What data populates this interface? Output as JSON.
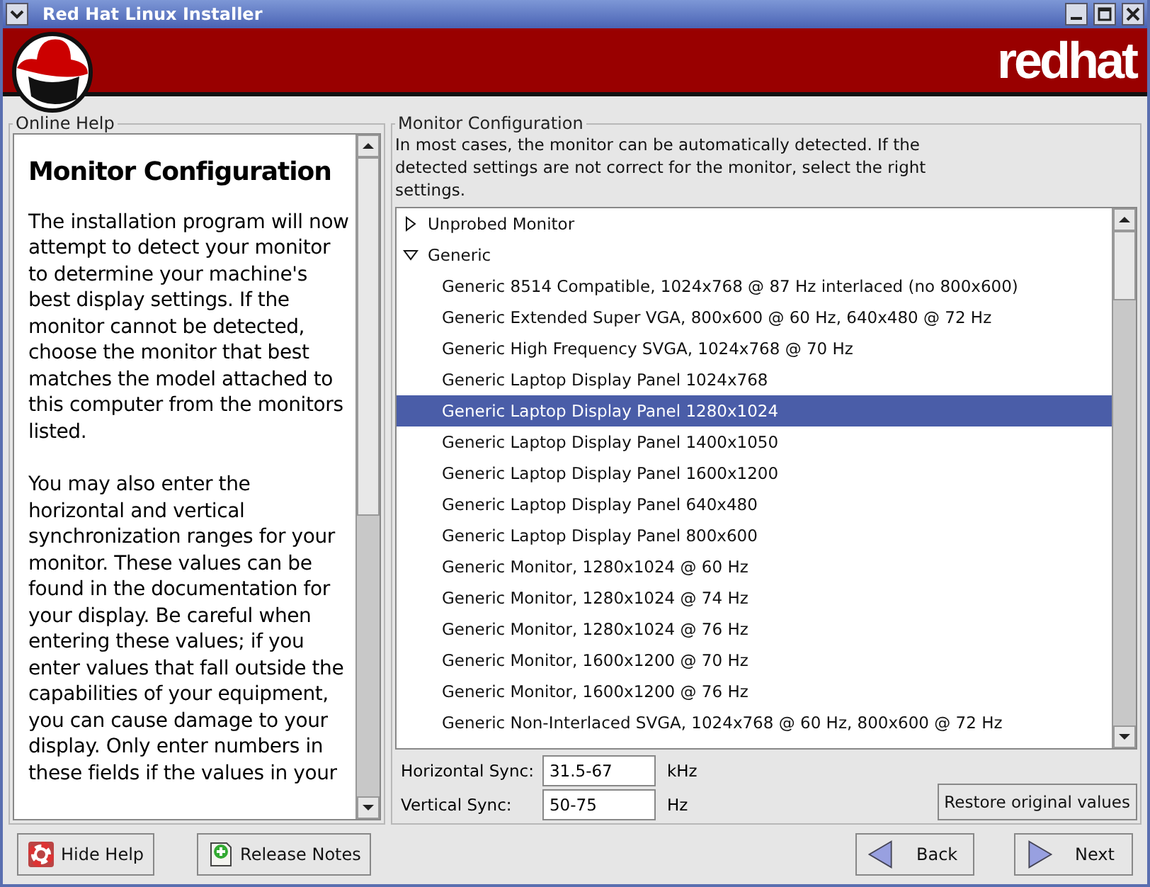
{
  "window": {
    "title": "Red Hat Linux Installer"
  },
  "header": {
    "logo_text": "redhat"
  },
  "online_help": {
    "title": "Online Help",
    "heading": "Monitor Configuration",
    "paragraphs": [
      "The installation program will now attempt to detect your monitor to determine your machine's best display settings. If the monitor cannot be detected, choose the monitor that best matches the model attached to this computer from the monitors listed.",
      "You may also enter the horizontal and vertical synchronization ranges for your monitor. These values can be found in the documentation for your display. Be careful when entering these values; if you enter values that fall outside the capabilities of your equipment, you can cause damage to your display. Only enter numbers in these fields if the values in your"
    ]
  },
  "monitor_config": {
    "title": "Monitor Configuration",
    "description": "In most cases, the monitor can be automatically detected. If the detected settings are not correct for the monitor, select the right settings.",
    "tree": [
      {
        "label": "Unprobed Monitor",
        "expanded": false,
        "selected": false
      },
      {
        "label": "Generic",
        "expanded": true,
        "selected": false,
        "children": [
          {
            "label": "Generic 8514 Compatible, 1024x768 @ 87 Hz interlaced (no 800x600)",
            "selected": false
          },
          {
            "label": "Generic Extended Super VGA, 800x600 @ 60 Hz, 640x480 @ 72 Hz",
            "selected": false
          },
          {
            "label": "Generic High Frequency SVGA, 1024x768 @ 70 Hz",
            "selected": false
          },
          {
            "label": "Generic Laptop Display Panel 1024x768",
            "selected": false
          },
          {
            "label": "Generic Laptop Display Panel 1280x1024",
            "selected": true
          },
          {
            "label": "Generic Laptop Display Panel 1400x1050",
            "selected": false
          },
          {
            "label": "Generic Laptop Display Panel 1600x1200",
            "selected": false
          },
          {
            "label": "Generic Laptop Display Panel 640x480",
            "selected": false
          },
          {
            "label": "Generic Laptop Display Panel 800x600",
            "selected": false
          },
          {
            "label": "Generic Monitor, 1280x1024 @ 60 Hz",
            "selected": false
          },
          {
            "label": "Generic Monitor, 1280x1024 @ 74 Hz",
            "selected": false
          },
          {
            "label": "Generic Monitor, 1280x1024 @ 76 Hz",
            "selected": false
          },
          {
            "label": "Generic Monitor, 1600x1200 @ 70 Hz",
            "selected": false
          },
          {
            "label": "Generic Monitor, 1600x1200 @ 76 Hz",
            "selected": false
          },
          {
            "label": "Generic Non-Interlaced SVGA, 1024x768 @ 60 Hz, 800x600 @ 72 Hz",
            "selected": false
          }
        ]
      }
    ],
    "sync_fields": [
      {
        "label": "Horizontal Sync:",
        "value": "31.5-67",
        "unit": "kHz"
      },
      {
        "label": "Vertical Sync:",
        "value": "50-75",
        "unit": "Hz"
      }
    ],
    "restore_button": "Restore original values"
  },
  "buttons": [
    {
      "label": "Hide Help",
      "kind": "help"
    },
    {
      "label": "Release Notes",
      "kind": "notes"
    },
    {
      "label": "Back",
      "kind": "back"
    },
    {
      "label": "Next",
      "kind": "next"
    }
  ]
}
